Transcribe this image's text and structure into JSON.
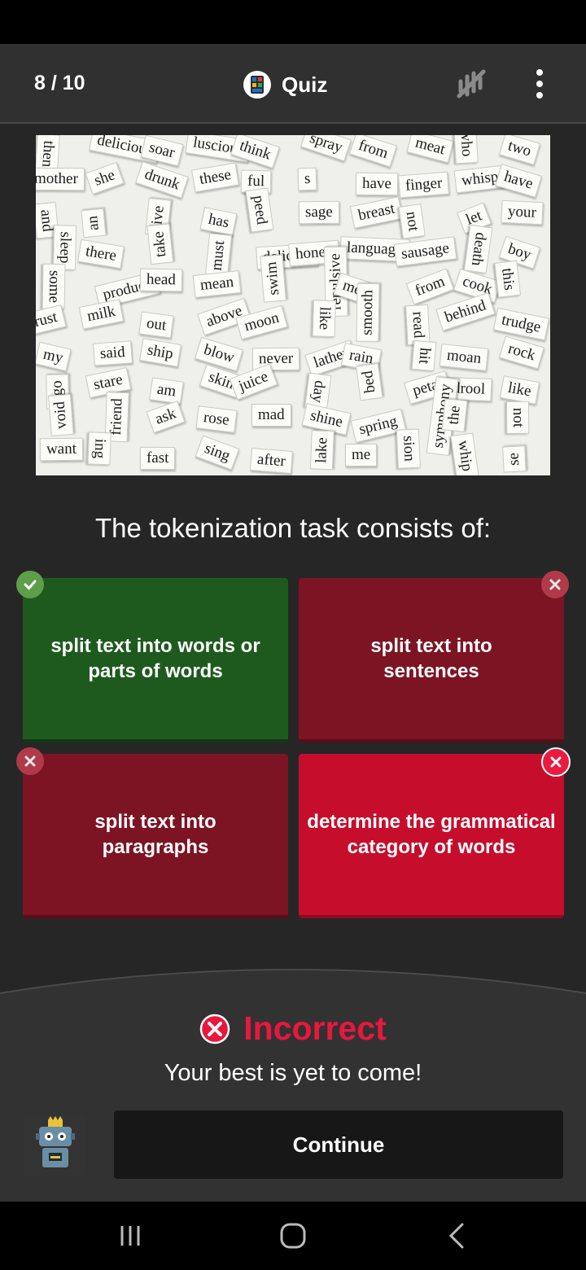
{
  "header": {
    "progress": "8 / 10",
    "title": "Quiz",
    "icons": [
      "quiz-logo-icon",
      "sound-off-icon",
      "more-vertical-icon"
    ]
  },
  "image": {
    "tiles": [
      {
        "text": "then"
      },
      {
        "text": "delicious"
      },
      {
        "text": "soar"
      },
      {
        "text": "luscious"
      },
      {
        "text": "think"
      },
      {
        "text": "spray"
      },
      {
        "text": "from"
      },
      {
        "text": "meat"
      },
      {
        "text": "who"
      },
      {
        "text": "two"
      },
      {
        "text": "mother"
      },
      {
        "text": "she"
      },
      {
        "text": "drunk"
      },
      {
        "text": "these"
      },
      {
        "text": "ful"
      },
      {
        "text": "s"
      },
      {
        "text": "have"
      },
      {
        "text": "finger"
      },
      {
        "text": "whisp"
      },
      {
        "text": "have"
      },
      {
        "text": "and"
      },
      {
        "text": "an"
      },
      {
        "text": "live"
      },
      {
        "text": "has"
      },
      {
        "text": "peed"
      },
      {
        "text": "sage"
      },
      {
        "text": "breast"
      },
      {
        "text": "not"
      },
      {
        "text": "let"
      },
      {
        "text": "your"
      },
      {
        "text": "sleep"
      },
      {
        "text": "there"
      },
      {
        "text": "take"
      },
      {
        "text": "must"
      },
      {
        "text": "delicate"
      },
      {
        "text": "honey"
      },
      {
        "text": "language"
      },
      {
        "text": "sausage"
      },
      {
        "text": "death"
      },
      {
        "text": "boy"
      },
      {
        "text": "some"
      },
      {
        "text": "produce"
      },
      {
        "text": "head"
      },
      {
        "text": "mean"
      },
      {
        "text": "swim"
      },
      {
        "text": "repulsive"
      },
      {
        "text": "me"
      },
      {
        "text": "from"
      },
      {
        "text": "cook"
      },
      {
        "text": "this"
      },
      {
        "text": "rust"
      },
      {
        "text": "milk"
      },
      {
        "text": "out"
      },
      {
        "text": "above"
      },
      {
        "text": "moon"
      },
      {
        "text": "like"
      },
      {
        "text": "smooth"
      },
      {
        "text": "read"
      },
      {
        "text": "behind"
      },
      {
        "text": "trudge"
      },
      {
        "text": "my"
      },
      {
        "text": "said"
      },
      {
        "text": "ship"
      },
      {
        "text": "blow"
      },
      {
        "text": "never"
      },
      {
        "text": "lather"
      },
      {
        "text": "rain"
      },
      {
        "text": "hit"
      },
      {
        "text": "moan"
      },
      {
        "text": "rock"
      },
      {
        "text": "ego"
      },
      {
        "text": "stare"
      },
      {
        "text": "am"
      },
      {
        "text": "skin"
      },
      {
        "text": "juice"
      },
      {
        "text": "day"
      },
      {
        "text": "bed"
      },
      {
        "text": "petal"
      },
      {
        "text": "drool"
      },
      {
        "text": "like"
      },
      {
        "text": "void"
      },
      {
        "text": "friend"
      },
      {
        "text": "ask"
      },
      {
        "text": "rose"
      },
      {
        "text": "mad"
      },
      {
        "text": "shine"
      },
      {
        "text": "spring"
      },
      {
        "text": "symphony"
      },
      {
        "text": "the"
      },
      {
        "text": "not"
      },
      {
        "text": "want"
      },
      {
        "text": "ing"
      },
      {
        "text": "fast"
      },
      {
        "text": "sing"
      },
      {
        "text": "after"
      },
      {
        "text": "lake"
      },
      {
        "text": "me"
      },
      {
        "text": "sion"
      },
      {
        "text": "whip"
      },
      {
        "text": "se"
      }
    ]
  },
  "question": "The tokenization task consists of:",
  "answers": [
    {
      "label": "split text into words or parts of words",
      "status": "correct"
    },
    {
      "label": "split text into sentences",
      "status": "wrong"
    },
    {
      "label": "split text into paragraphs",
      "status": "wrong"
    },
    {
      "label": "determine the grammatical category of words",
      "status": "selected-wrong"
    }
  ],
  "feedback": {
    "result": "Incorrect",
    "message": "Your best is yet to come!",
    "continue_label": "Continue",
    "result_color": "#e8173e"
  },
  "colors": {
    "correct": "#1e5a1e",
    "wrong": "#7c1424",
    "selected_wrong": "#c60d2c",
    "background": "#262626"
  }
}
